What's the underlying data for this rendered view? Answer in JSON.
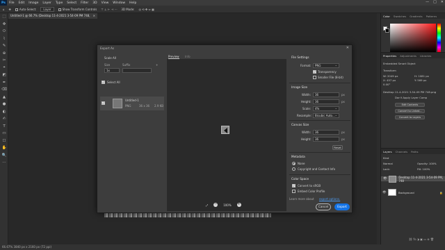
{
  "app": {
    "logo": "Ps",
    "menu": [
      "File",
      "Edit",
      "Image",
      "Layer",
      "Type",
      "Select",
      "Filter",
      "3D",
      "View",
      "Window",
      "Help"
    ],
    "window_controls": [
      "—",
      "□",
      "✕"
    ]
  },
  "options_bar": {
    "auto_select": "Auto-Select:",
    "layer_select": "Layer",
    "show_transform": "Show Transform Controls",
    "mode_3d": "3D Mode:"
  },
  "document": {
    "tab_title": "Untitled-1 @ 66.7% (Desktop 11-4-2021 3-54-09 PM 748, RGB/8)",
    "tab_close": "×"
  },
  "status_bar": {
    "text": "66.67%     3840 px x 2160 px (72 ppi)"
  },
  "tools": [
    "⬚",
    "✥",
    "⬭",
    "⌇",
    "✎",
    "⊕",
    "✂",
    "⌖",
    "◩",
    "✒",
    "⌫",
    "▲",
    "●",
    "◐",
    "✍",
    "T",
    "▭",
    "☐",
    "✋",
    "🔍",
    "⋯"
  ],
  "color_panel": {
    "tabs": [
      "Color",
      "Swatches",
      "Gradients",
      "Patterns"
    ],
    "accent_hex": "#ff1a1a"
  },
  "properties_panel": {
    "tabs": [
      "Properties",
      "Adjustments",
      "Libraries"
    ],
    "layer_type": "Embedded Smart Object",
    "transform_label": "Transform",
    "w": "W: 2049 px",
    "h": "H: 1081 px",
    "x": "X: 457 px",
    "y": "Y: 569 px",
    "angle": "0.00°",
    "file_name": "Desktop 11-4-2021 3-54-09 PM 748.png",
    "blend_ghost": "Don't Apply Layer Comp",
    "edit_contents": "Edit Contents",
    "convert_linked": "Convert to Linked...",
    "embed_layers": "Convert to Layers"
  },
  "layers_panel": {
    "tabs": [
      "Layers",
      "Channels",
      "Paths"
    ],
    "kind": "Kind",
    "blend": "Normal",
    "opacity": "Opacity: 100%",
    "lock": "Lock:",
    "fill": "Fill: 100%",
    "layers": [
      {
        "name": "Desktop 11-4-2021 3-54-09 PM 748",
        "selected": true
      },
      {
        "name": "Background",
        "selected": false
      }
    ]
  },
  "export_dialog": {
    "title": "Export As",
    "close": "✕",
    "scale_all": "Scale All",
    "size_label": "Size",
    "suffix_label": "Suffix",
    "size_value": "1x",
    "select_all": "Select All",
    "asset_name": "Untitled-1",
    "asset_format": "PNG",
    "asset_dims": "36 x 36",
    "asset_size": "2.9 KB",
    "preview_tab": "Preview",
    "info_tab": "Info",
    "zoom_level": "100%",
    "file_settings": "File Settings",
    "format_label": "Format:",
    "format_value": "PNG",
    "transparency": "Transparency",
    "smaller_file": "Smaller File (8-bit)",
    "image_size": "Image Size",
    "width_label": "Width:",
    "width_value": "36",
    "height_label": "Height:",
    "height_value": "36",
    "scale_label": "Scale:",
    "scale_value": "4%",
    "resample_label": "Resample:",
    "resample_value": "Bicubic Auto...",
    "unit_px": "px",
    "canvas_size": "Canvas Size",
    "cwidth_value": "36",
    "cheight_value": "36",
    "reset": "Reset",
    "metadata": "Metadata",
    "meta_none": "None",
    "meta_copyright": "Copyright and Contact Info",
    "color_space": "Color Space",
    "convert_srgb": "Convert to sRGB",
    "embed_profile": "Embed Color Profile",
    "learn_more": "Learn more about",
    "export_options": "export options.",
    "cancel": "Cancel",
    "export": "Export"
  }
}
